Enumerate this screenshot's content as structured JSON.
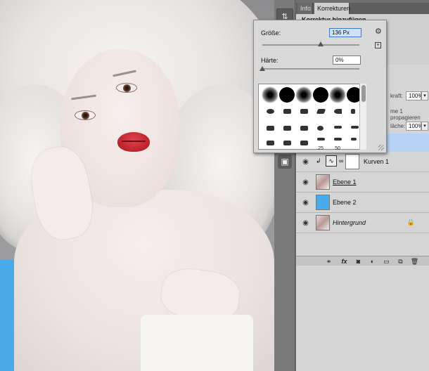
{
  "panels": {
    "tabs": [
      {
        "label": "Info",
        "active": false
      },
      {
        "label": "Korrekturen",
        "active": true
      }
    ],
    "adjustments_title": "Korrektur hinzufügen"
  },
  "brush_popup": {
    "size_label": "Größe:",
    "size_value": "136 Px",
    "hardness_label": "Härte:",
    "hardness_value": "0%",
    "size_slider_fraction": 0.5,
    "hardness_slider_fraction": 0.0,
    "preset_labels": [
      "25",
      "50"
    ],
    "icons": [
      "gear-icon",
      "new-preset-icon",
      "resize-grip-icon"
    ]
  },
  "layers_panel": {
    "opacity_label": "kraft:",
    "opacity_value": "100%",
    "propagate_text": "me 1 propagieren",
    "fill_label": "läche:",
    "fill_value": "100%",
    "layers": [
      {
        "name": "",
        "visible": true,
        "selected": true,
        "thumb": "white",
        "italic": false,
        "underline": false
      },
      {
        "name": "Kurven 1",
        "visible": true,
        "selected": false,
        "thumb": "curves",
        "italic": false,
        "underline": false
      },
      {
        "name": "Ebene 1",
        "visible": true,
        "selected": false,
        "thumb": "photo",
        "italic": false,
        "underline": true
      },
      {
        "name": "Ebene 2",
        "visible": true,
        "selected": false,
        "thumb": "blue",
        "italic": false,
        "underline": false
      },
      {
        "name": "Hintergrund",
        "visible": true,
        "selected": false,
        "thumb": "photo",
        "italic": true,
        "underline": false,
        "locked": true
      }
    ],
    "footer_icons": [
      "link-icon",
      "fx-icon",
      "mask-icon",
      "adjustment-icon",
      "folder-icon",
      "new-layer-icon",
      "trash-icon"
    ],
    "colors": {
      "selected_row": "#b6d3f6",
      "blue_layer": "#4aa9e8"
    }
  }
}
